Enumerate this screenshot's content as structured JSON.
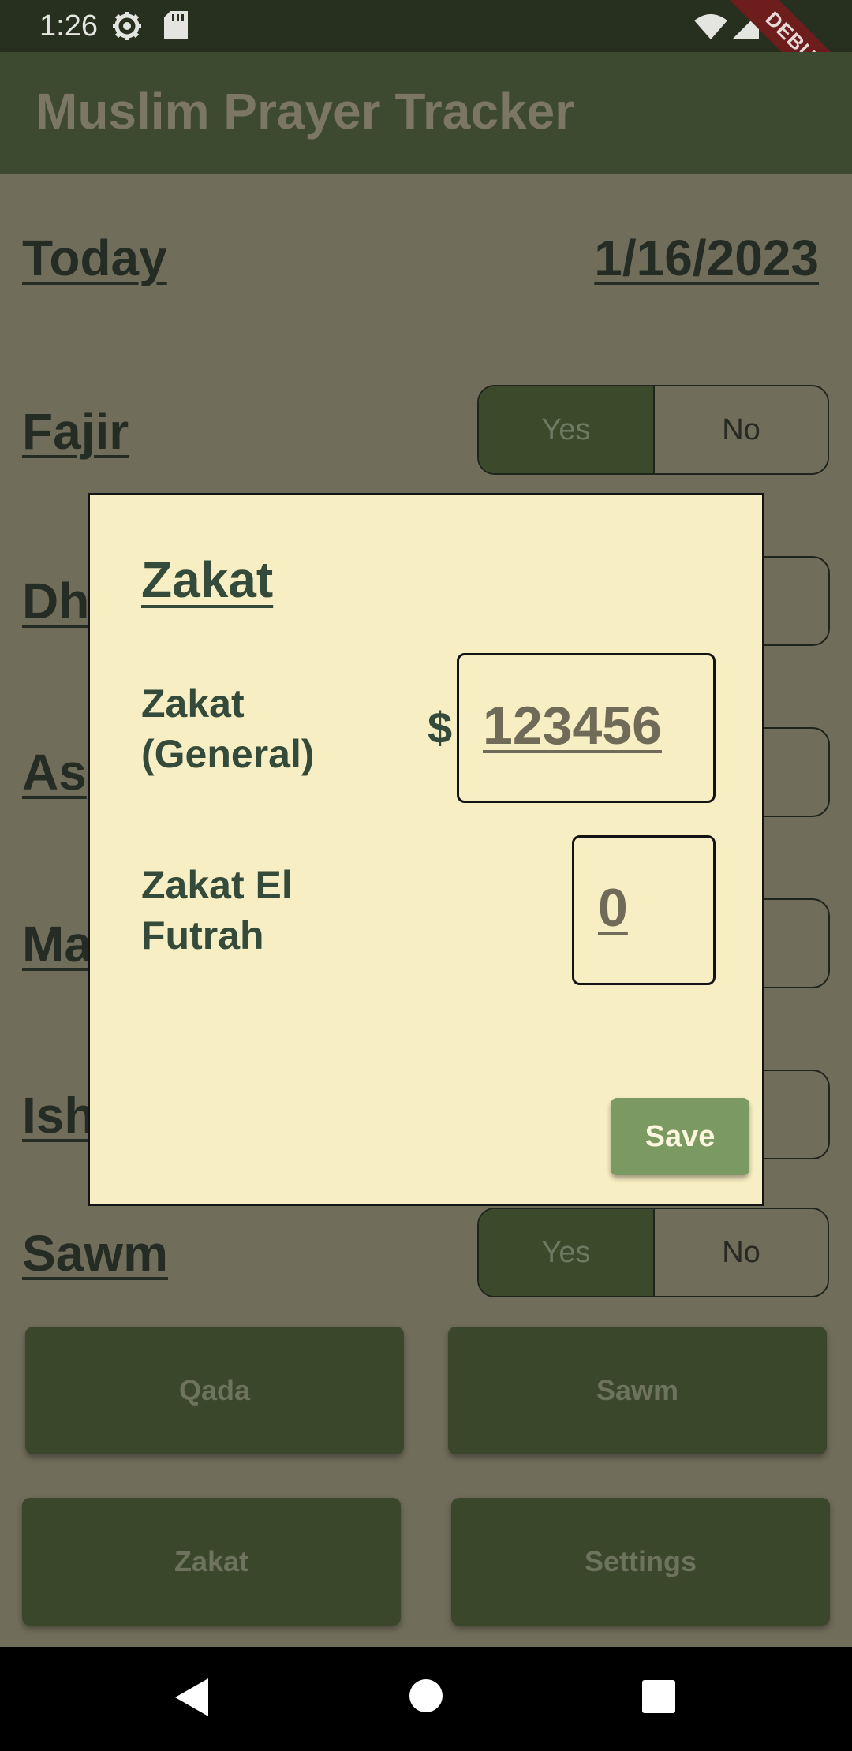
{
  "status_bar": {
    "time": "1:26",
    "left_icons": [
      "settings-gear-icon",
      "sd-card-icon"
    ],
    "right_icons": [
      "wifi-icon",
      "cellular-signal-icon",
      "battery-icon"
    ],
    "debug_label": "DEBUG"
  },
  "app_bar": {
    "title": "Muslim Prayer Tracker"
  },
  "today": {
    "label": "Today",
    "date": "1/16/2023"
  },
  "prayers": [
    {
      "name": "Fajir",
      "yes": "Yes",
      "no": "No",
      "selected": "Yes"
    },
    {
      "name": "Dh"
    },
    {
      "name": "As"
    },
    {
      "name": "Ma"
    },
    {
      "name": "Ish"
    }
  ],
  "sawm_row": {
    "name": "Sawm",
    "yes": "Yes",
    "no": "No",
    "selected": "Yes"
  },
  "nav_buttons": [
    "Qada",
    "Sawm",
    "Zakat",
    "Settings"
  ],
  "dialog": {
    "title": "Zakat",
    "fields": [
      {
        "label": "Zakat\n(General)",
        "currency": "$",
        "value": "123456"
      },
      {
        "label": "Zakat El\nFutrah",
        "value": "0"
      }
    ],
    "save_label": "Save"
  },
  "system_nav": [
    "back-icon",
    "home-icon",
    "recents-icon"
  ],
  "colors": {
    "app_bar": "#3e4a2f",
    "dimmed_background": "#716d5b",
    "dialog_background": "#f8eec3",
    "dialog_text": "#344a3a",
    "save_button": "#7b9a62",
    "debug_banner": "#6e1d1d"
  }
}
